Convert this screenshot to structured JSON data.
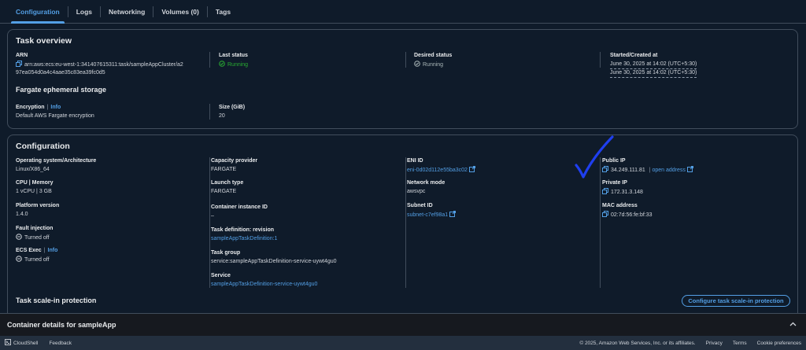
{
  "tabs": [
    {
      "label": "Configuration",
      "active": true
    },
    {
      "label": "Logs"
    },
    {
      "label": "Networking"
    },
    {
      "label": "Volumes (0)"
    },
    {
      "label": "Tags"
    }
  ],
  "task_overview": {
    "title": "Task overview",
    "arn_label": "ARN",
    "arn_line1": "arn:aws:ecs:eu-west-1:341407615311:task/sampleAppCluster/a2",
    "arn_line2": "97ea054d0a4c4aae35c83ea39fc0d5",
    "last_status_label": "Last status",
    "last_status_value": "Running",
    "desired_status_label": "Desired status",
    "desired_status_value": "Running",
    "started_label": "Started/Created at",
    "started_value": "June 30, 2025 at 14:02 (UTC+5:30)",
    "created_value": "June 30, 2025 at 14:02 (UTC+5:30)",
    "storage_title": "Fargate ephemeral storage",
    "encryption_label": "Encryption",
    "encryption_info": "Info",
    "encryption_value": "Default AWS Fargate encryption",
    "size_label": "Size (GiB)",
    "size_value": "20"
  },
  "configuration": {
    "title": "Configuration",
    "os_label": "Operating system/Architecture",
    "os_value": "Linux/X86_64",
    "cpu_label": "CPU | Memory",
    "cpu_value": "1 vCPU | 3 GB",
    "platform_label": "Platform version",
    "platform_value": "1.4.0",
    "fault_label": "Fault injection",
    "fault_value": "Turned off",
    "ecs_exec_label": "ECS Exec",
    "ecs_exec_info": "Info",
    "ecs_exec_value": "Turned off",
    "capacity_label": "Capacity provider",
    "capacity_value": "FARGATE",
    "launch_label": "Launch type",
    "launch_value": "FARGATE",
    "container_instance_label": "Container instance ID",
    "container_instance_value": "–",
    "task_def_label": "Task definition: revision",
    "task_def_value": "sampleAppTaskDefinition:1",
    "task_group_label": "Task group",
    "task_group_value": "service:sampleAppTaskDefinition-service-uywt4gu0",
    "service_label": "Service",
    "service_value": "sampleAppTaskDefinition-service-uywt4gu0",
    "eni_label": "ENI ID",
    "eni_value": "eni-0d02d112e55ba3c02",
    "network_mode_label": "Network mode",
    "network_mode_value": "awsvpc",
    "subnet_label": "Subnet ID",
    "subnet_value": "subnet-c7ef98a1",
    "public_ip_label": "Public IP",
    "public_ip_value": "34.249.111.81",
    "open_address": "open address",
    "private_ip_label": "Private IP",
    "private_ip_value": "172.31.3.148",
    "mac_label": "MAC address",
    "mac_value": "02:7d:56:fe:bf:33",
    "scale_in_title": "Task scale-in protection",
    "scale_in_button": "Configure task scale-in protection"
  },
  "container_details": {
    "title": "Container details for sampleApp"
  },
  "footer": {
    "cloudshell": "CloudShell",
    "feedback": "Feedback",
    "copyright": "© 2025, Amazon Web Services, Inc. or its affiliates.",
    "privacy": "Privacy",
    "terms": "Terms",
    "cookies": "Cookie preferences"
  },
  "colors": {
    "background": "#0f1b2a",
    "accent": "#539fe5",
    "success": "#29ad32",
    "annotation": "#1f3ff0"
  },
  "icons": [
    "copy-icon",
    "check-circle-icon",
    "status-circle-icon",
    "external-link-icon",
    "chevron-up-icon",
    "cloudshell-icon",
    "checkmark-annotation"
  ]
}
